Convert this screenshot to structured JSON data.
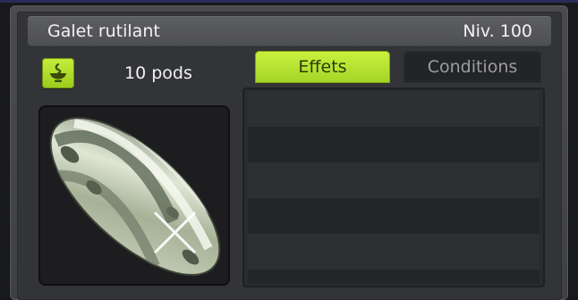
{
  "item": {
    "name": "Galet rutilant",
    "level": "Niv. 100",
    "weight": "10 pods",
    "image_icon": "shiny-pebble-icon"
  },
  "actions": {
    "craft_icon": "crafting-bowl-icon"
  },
  "tabs": [
    {
      "label": "Effets",
      "active": true
    },
    {
      "label": "Conditions",
      "active": false
    }
  ],
  "effects": [],
  "colors": {
    "accent_green": "#b6e22f",
    "panel_bg": "#333437",
    "title_bar": "#56575a",
    "tab_inactive": "#232427"
  }
}
